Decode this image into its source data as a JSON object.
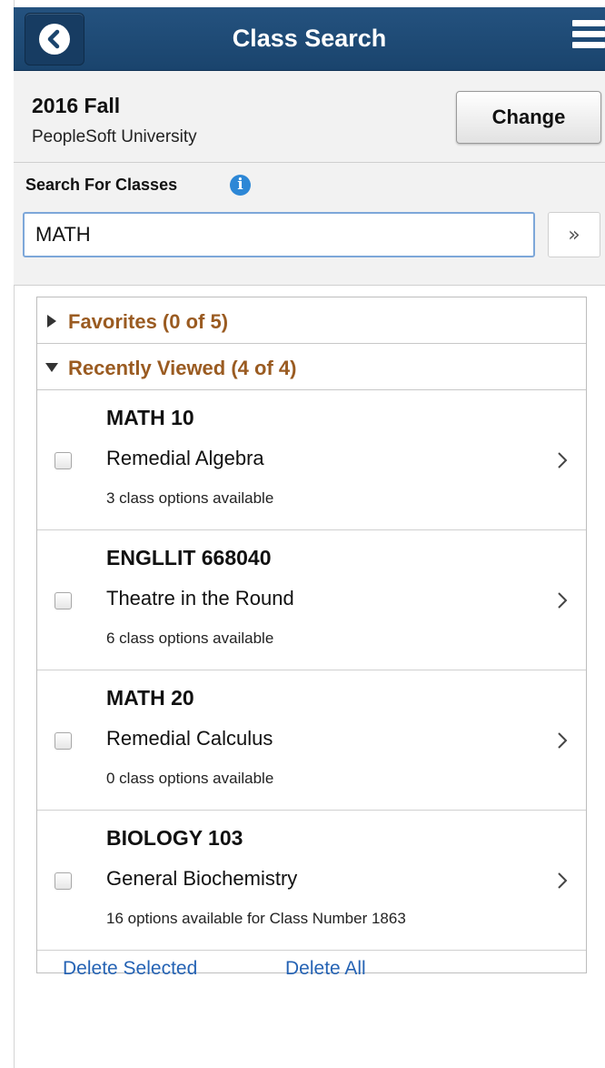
{
  "header": {
    "title": "Class Search"
  },
  "term": {
    "name": "2016 Fall",
    "institution": "PeopleSoft University",
    "change_label": "Change"
  },
  "search": {
    "label": "Search For Classes",
    "value": "MATH",
    "go_glyph": "»"
  },
  "groups": {
    "favorites": {
      "label": "Favorites (0 of 5)",
      "state": "collapsed"
    },
    "recent": {
      "label": "Recently Viewed (4 of 4)",
      "state": "expanded"
    }
  },
  "items": [
    {
      "code": "MATH 10",
      "title": "Remedial Algebra",
      "options": "3 class options available"
    },
    {
      "code": "ENGLLIT 668040",
      "title": "Theatre in the Round",
      "options": "6 class options available"
    },
    {
      "code": "MATH 20",
      "title": "Remedial Calculus",
      "options": "0 class options available"
    },
    {
      "code": "BIOLOGY 103",
      "title": "General Biochemistry",
      "options": "16 options available for Class Number 1863"
    }
  ],
  "actions": {
    "delete_selected": "Delete Selected",
    "delete_all": "Delete All"
  },
  "icons": [
    "back-icon",
    "hamburger-menu-icon",
    "info-icon",
    "double-chevron-right-icon",
    "triangle-right-icon",
    "triangle-down-icon",
    "chevron-right-icon",
    "checkbox"
  ],
  "colors": {
    "header_bg": "#1f4b77",
    "group_text": "#9a5b21",
    "link": "#2563b4",
    "info": "#2d87d6",
    "panel_bg": "#f2f2f2"
  }
}
